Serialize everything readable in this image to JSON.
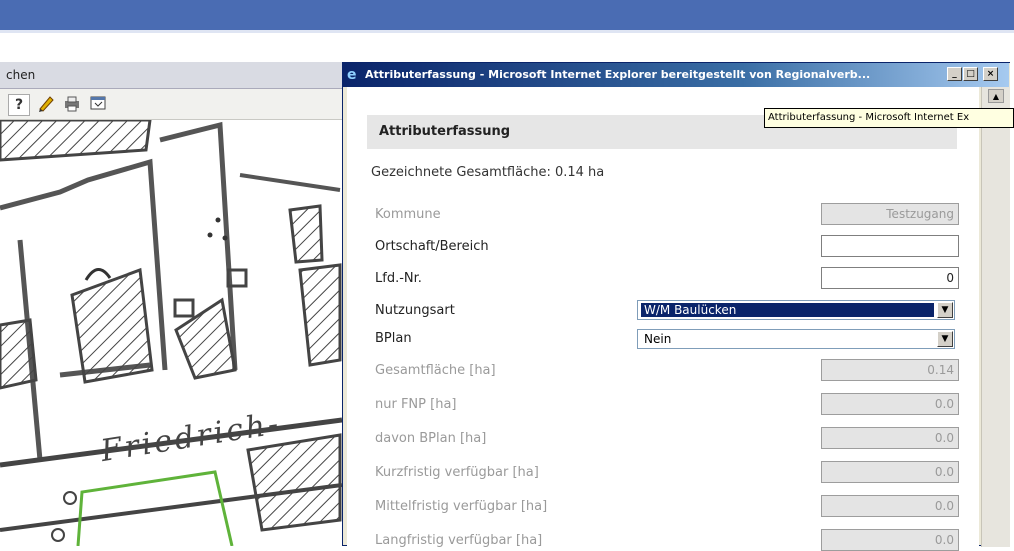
{
  "left_window": {
    "title": "chen",
    "toolbar": {
      "help": "?"
    },
    "map_label": "Friedrich-"
  },
  "dialog": {
    "title": "Attributerfassung - Microsoft Internet Explorer bereitgestellt von Regionalverb...",
    "buttons": {
      "minimize": "_",
      "maximize": "□",
      "close": "×"
    },
    "tooltip": "Attributerfassung - Microsoft Internet Ex",
    "heading": "Attributerfassung",
    "total_area": "Gezeichnete Gesamtfläche: 0.14 ha",
    "fields": {
      "kommune": {
        "label": "Kommune",
        "value": "Testzugang"
      },
      "ortschaft": {
        "label": "Ortschaft/Bereich",
        "value": ""
      },
      "lfd_nr": {
        "label": "Lfd.-Nr.",
        "value": "0"
      },
      "nutzungsart": {
        "label": "Nutzungsart",
        "selected": "W/M Baulücken"
      },
      "bplan": {
        "label": "BPlan",
        "selected": "Nein"
      },
      "gesamtflaeche": {
        "label": "Gesamtfläche [ha]",
        "value": "0.14"
      },
      "nur_fnp": {
        "label": "nur FNP [ha]",
        "value": "0.0"
      },
      "davon_bplan": {
        "label": "davon BPlan [ha]",
        "value": "0.0"
      },
      "kurzfristig": {
        "label": "Kurzfristig verfügbar [ha]",
        "value": "0.0"
      },
      "mittelfristig": {
        "label": "Mittelfristig verfügbar [ha]",
        "value": "0.0"
      },
      "langfristig": {
        "label": "Langfristig verfügbar [ha]",
        "value": "0.0"
      }
    }
  },
  "colors": {
    "title_bar": "#0a246a",
    "top_bar": "#4a6cb3",
    "selection": "#0a246a",
    "parcel_outline": "#5fb33a"
  }
}
